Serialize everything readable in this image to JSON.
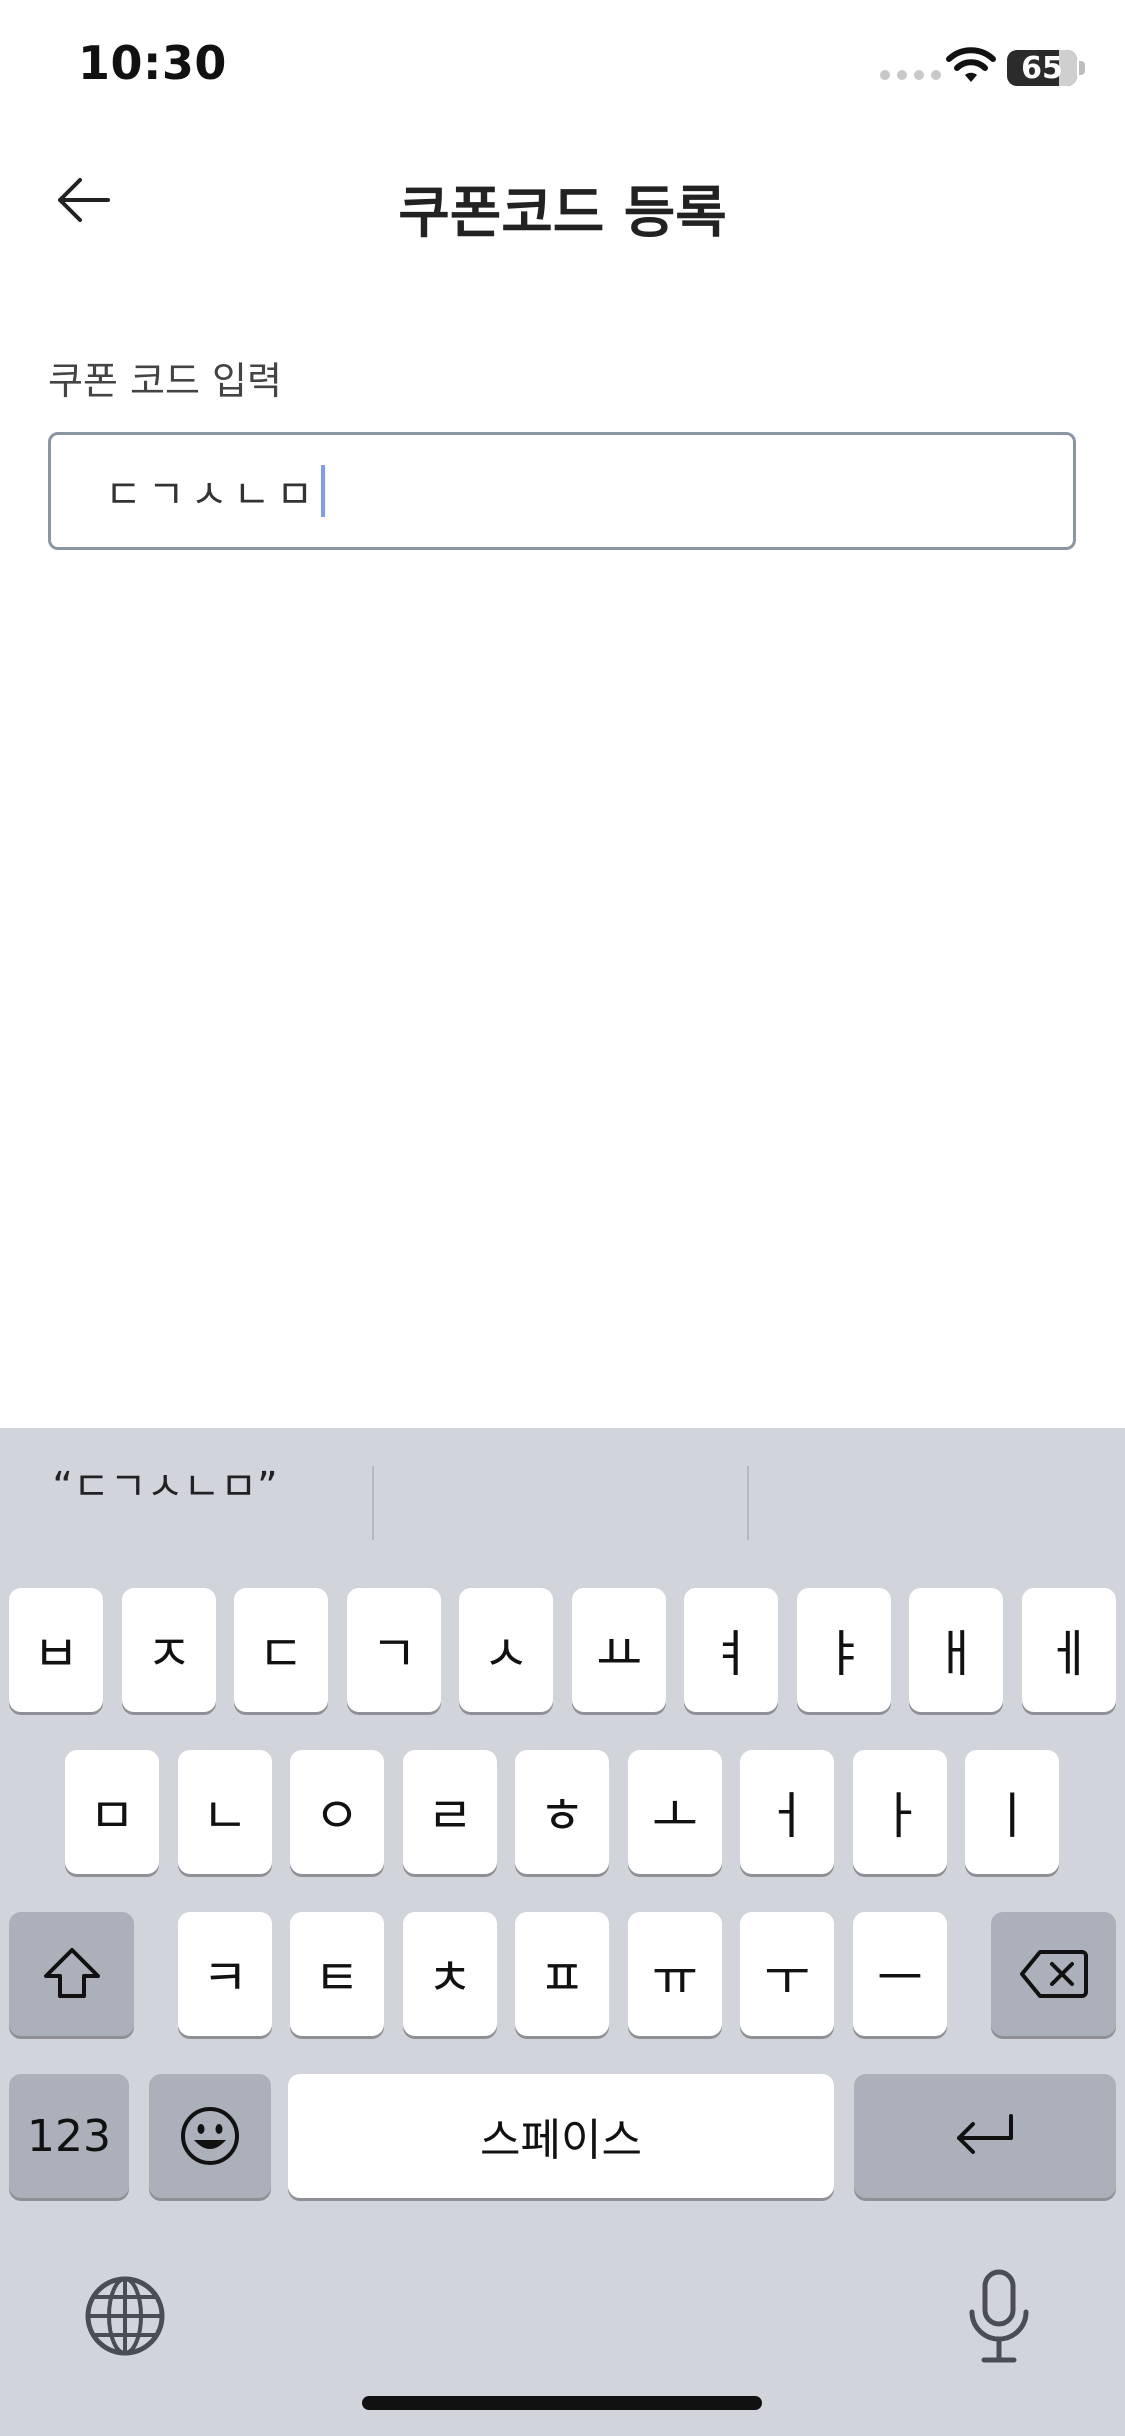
{
  "status": {
    "time": "10:30",
    "battery": "65"
  },
  "header": {
    "title": "쿠폰코드 등록"
  },
  "form": {
    "label": "쿠폰 코드 입력",
    "value": "ㄷㄱㅅㄴㅁ"
  },
  "keyboard": {
    "suggestion": "“ㄷㄱㅅㄴㅁ”",
    "row1": [
      "ㅂ",
      "ㅈ",
      "ㄷ",
      "ㄱ",
      "ㅅ",
      "ㅛ",
      "ㅕ",
      "ㅑ",
      "ㅐ",
      "ㅔ"
    ],
    "row2": [
      "ㅁ",
      "ㄴ",
      "ㅇ",
      "ㄹ",
      "ㅎ",
      "ㅗ",
      "ㅓ",
      "ㅏ",
      "ㅣ"
    ],
    "row3": [
      "ㅋ",
      "ㅌ",
      "ㅊ",
      "ㅍ",
      "ㅠ",
      "ㅜ",
      "ㅡ"
    ],
    "numbers_label": "123",
    "space_label": "스페이스"
  },
  "icons": {
    "back": "arrow-left-icon",
    "wifi": "wifi-icon",
    "shift": "shift-icon",
    "delete": "backspace-icon",
    "emoji": "emoji-icon",
    "return": "return-icon",
    "globe": "globe-icon",
    "mic": "microphone-icon"
  }
}
